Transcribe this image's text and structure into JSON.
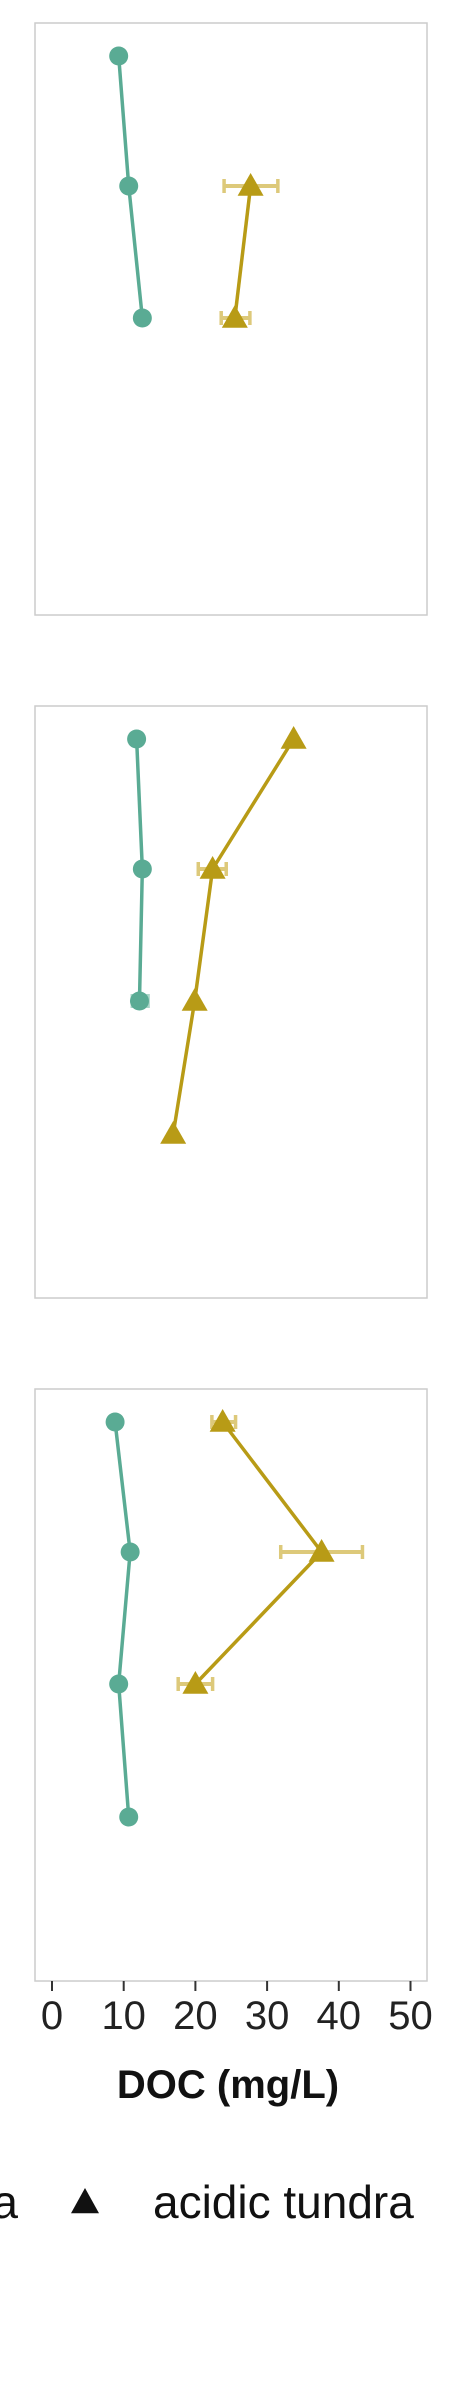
{
  "chart_data": {
    "type": "line",
    "orientation": "vertical-profile",
    "xlabel": "DOC (mg/L)",
    "xlim": [
      -2,
      51
    ],
    "xticks": [
      0,
      10,
      20,
      30,
      40,
      50
    ],
    "grid": false,
    "legend": {
      "placement": "bottom",
      "items": [
        {
          "label": "...a",
          "marker": "circle",
          "series_key": "s1"
        },
        {
          "label": "acidic tundra",
          "marker": "triangle",
          "series_key": "s2"
        }
      ]
    },
    "colors": {
      "s1": "#5aab94",
      "s2": "#b89b16",
      "s2_error": "#ddc97a",
      "s1_error": "#a9d6c8"
    },
    "panels": [
      {
        "series": [
          {
            "key": "s1",
            "points": [
              {
                "depth": 1,
                "x": 9.3
              },
              {
                "depth": 2,
                "x": 10.7
              },
              {
                "depth": 3,
                "x": 12.6
              }
            ]
          },
          {
            "key": "s2",
            "points": [
              {
                "depth": 2,
                "x": 27.7,
                "err": [
                  24.0,
                  31.5
                ]
              },
              {
                "depth": 3,
                "x": 25.5,
                "err": [
                  23.6,
                  27.6
                ]
              }
            ]
          }
        ]
      },
      {
        "series": [
          {
            "key": "s1",
            "points": [
              {
                "depth": 1,
                "x": 11.8
              },
              {
                "depth": 2,
                "x": 12.6
              },
              {
                "depth": 3,
                "x": 12.2,
                "err": [
                  11.2,
                  13.4
                ]
              }
            ]
          },
          {
            "key": "s2",
            "points": [
              {
                "depth": 1,
                "x": 33.7
              },
              {
                "depth": 2,
                "x": 22.4,
                "err": [
                  20.4,
                  24.3
                ]
              },
              {
                "depth": 3,
                "x": 19.9
              },
              {
                "depth": 4,
                "x": 16.9
              }
            ]
          }
        ]
      },
      {
        "series": [
          {
            "key": "s1",
            "points": [
              {
                "depth": 1,
                "x": 8.8
              },
              {
                "depth": 2,
                "x": 10.9
              },
              {
                "depth": 3,
                "x": 9.3
              },
              {
                "depth": 4,
                "x": 10.7
              }
            ]
          },
          {
            "key": "s2",
            "points": [
              {
                "depth": 1,
                "x": 23.8,
                "err": [
                  22.3,
                  25.6
                ]
              },
              {
                "depth": 2,
                "x": 37.6,
                "err": [
                  31.9,
                  43.3
                ]
              },
              {
                "depth": 3,
                "x": 20.0,
                "err": [
                  17.6,
                  22.4
                ]
              }
            ]
          }
        ]
      }
    ]
  }
}
